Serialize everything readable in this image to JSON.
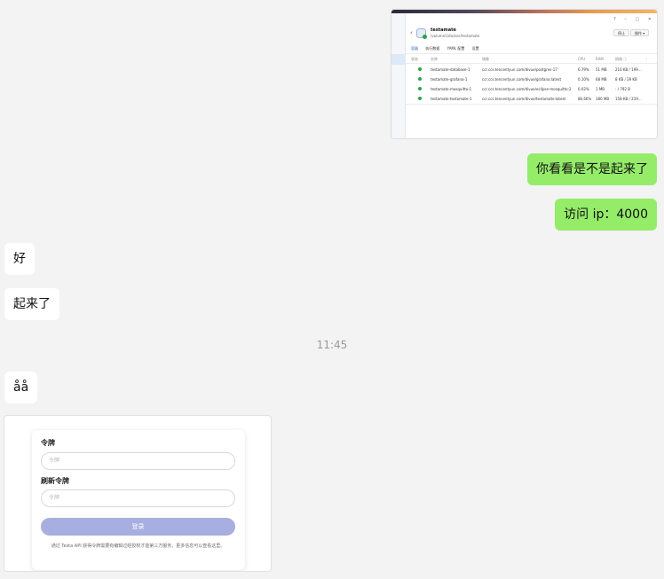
{
  "screenshot_window": {
    "title": "testamate",
    "path": "/volume1/docker/testamate",
    "window_controls": "? – ▢ ✕",
    "buttons": [
      "停止",
      "操作 ▾"
    ],
    "tabs": [
      "容器",
      "执行数据",
      "YAML 配置",
      "设置"
    ],
    "table_headers": [
      "状态",
      "名称",
      "镜像",
      "CPU",
      "RAM",
      "网络 ⓘ",
      "⋮"
    ],
    "rows": [
      {
        "name": "testamate-database-1",
        "image": "ccr.ccs.tencentyun.com/divue/postgres-17",
        "cpu": "6.79%",
        "ram": "51 MB",
        "net": "216 KB / 199..."
      },
      {
        "name": "testamate-grafana-1",
        "image": "ccr.ccs.tencentyun.com/divue/grafana:latest",
        "cpu": "0.10%",
        "ram": "68 MB",
        "net": "8 KB / 29 KB"
      },
      {
        "name": "testamate-mosquitto-1",
        "image": "ccr.ccs.tencentyun.com/divue/eclipse-mosquitto:2",
        "cpu": "0.02%",
        "ram": "1 MB",
        "net": "- / 792 B"
      },
      {
        "name": "testamate-testamate-1",
        "image": "ccr.ccs.tencentyun.com/divue/testamate:latest",
        "cpu": "86.66%",
        "ram": "186 MB",
        "net": "158 KB / 219..."
      }
    ]
  },
  "messages": {
    "out1": "你看看是不是起来了",
    "out2": "访问 ip：4000",
    "in1": "好",
    "in2": "起来了",
    "time": "11:45",
    "in3": "åå"
  },
  "login_card": {
    "token_label": "令牌",
    "token_placeholder": "令牌",
    "refresh_label": "刷新令牌",
    "refresh_placeholder": "令牌",
    "login_button": "登录",
    "note": "通过 Testa API 获得令牌需要有编辑过经授权才能第三方服务，更多信息可以查看这里。"
  }
}
